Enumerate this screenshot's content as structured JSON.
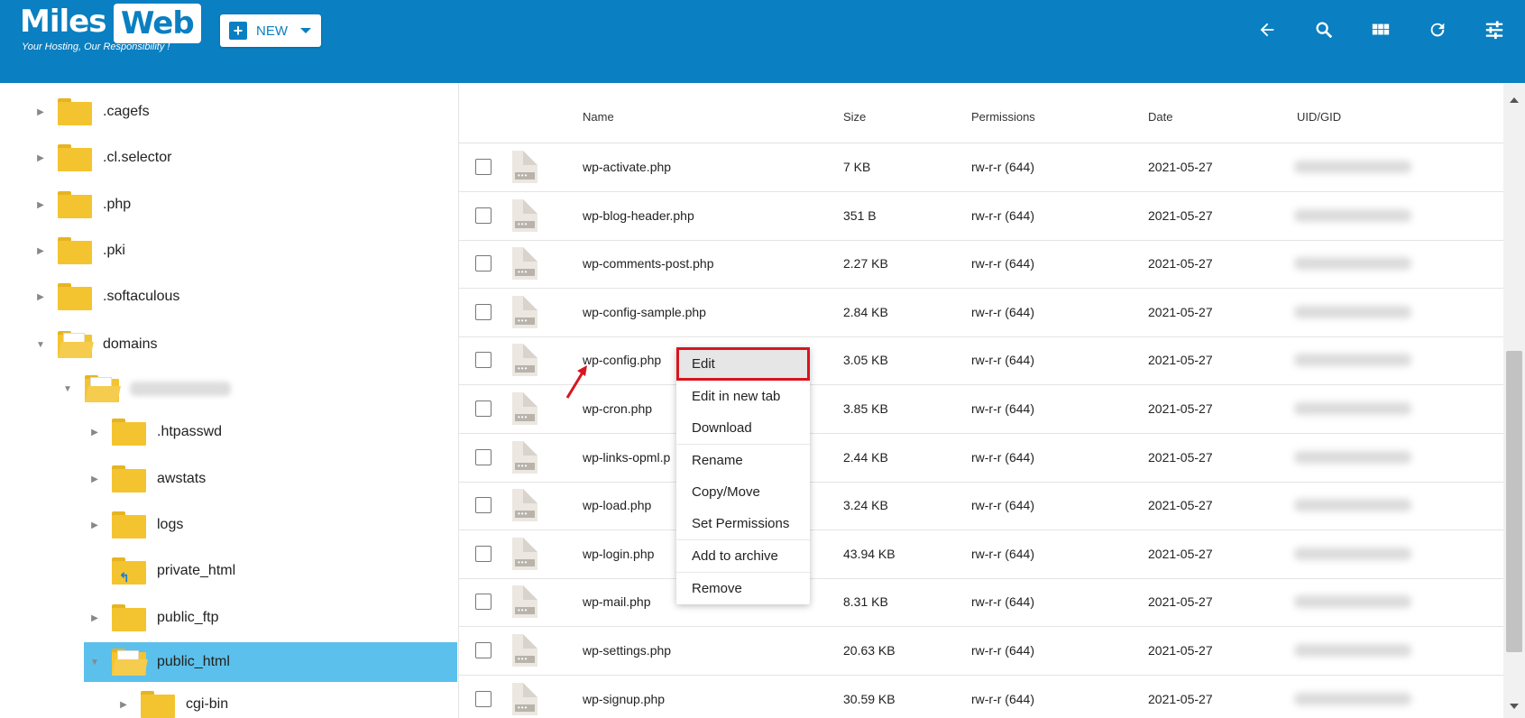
{
  "header": {
    "logo_miles": "Miles",
    "logo_web": "Web",
    "tagline": "Your Hosting, Our Responsibility !",
    "new_button": "NEW",
    "icons": [
      "back-arrow-icon",
      "search-icon",
      "grid-view-icon",
      "refresh-icon",
      "settings-sliders-icon"
    ],
    "accent_color": "#0a7fc1"
  },
  "sidebar": {
    "items": [
      {
        "label": ".cagefs",
        "expanded": false,
        "level": 0
      },
      {
        "label": ".cl.selector",
        "expanded": false,
        "level": 0
      },
      {
        "label": ".php",
        "expanded": false,
        "level": 0
      },
      {
        "label": ".pki",
        "expanded": false,
        "level": 0
      },
      {
        "label": ".softaculous",
        "expanded": false,
        "level": 0
      },
      {
        "label": "domains",
        "expanded": true,
        "level": 0
      },
      {
        "label": "",
        "expanded": true,
        "level": 1,
        "blurred": true
      },
      {
        "label": ".htpasswd",
        "expanded": false,
        "level": 2
      },
      {
        "label": "awstats",
        "expanded": false,
        "level": 2
      },
      {
        "label": "logs",
        "expanded": false,
        "level": 2
      },
      {
        "label": "private_html",
        "expanded": false,
        "level": 2,
        "link": true
      },
      {
        "label": "public_ftp",
        "expanded": false,
        "level": 2
      },
      {
        "label": "public_html",
        "expanded": true,
        "level": 2,
        "selected": true
      },
      {
        "label": "cgi-bin",
        "expanded": false,
        "level": 3
      }
    ],
    "selected_color": "#5bc0eb"
  },
  "table": {
    "columns": [
      "Name",
      "Size",
      "Permissions",
      "Date",
      "UID/GID"
    ],
    "rows": [
      {
        "name": "wp-activate.php",
        "size": "7 KB",
        "perm": "rw-r-r (644)",
        "date": "2021-05-27"
      },
      {
        "name": "wp-blog-header.php",
        "size": "351 B",
        "perm": "rw-r-r (644)",
        "date": "2021-05-27"
      },
      {
        "name": "wp-comments-post.php",
        "size": "2.27 KB",
        "perm": "rw-r-r (644)",
        "date": "2021-05-27"
      },
      {
        "name": "wp-config-sample.php",
        "size": "2.84 KB",
        "perm": "rw-r-r (644)",
        "date": "2021-05-27"
      },
      {
        "name": "wp-config.php",
        "size": "3.05 KB",
        "perm": "rw-r-r (644)",
        "date": "2021-05-27"
      },
      {
        "name": "wp-cron.php",
        "size": "3.85 KB",
        "perm": "rw-r-r (644)",
        "date": "2021-05-27"
      },
      {
        "name": "wp-links-opml.p",
        "size": "2.44 KB",
        "perm": "rw-r-r (644)",
        "date": "2021-05-27"
      },
      {
        "name": "wp-load.php",
        "size": "3.24 KB",
        "perm": "rw-r-r (644)",
        "date": "2021-05-27"
      },
      {
        "name": "wp-login.php",
        "size": "43.94 KB",
        "perm": "rw-r-r (644)",
        "date": "2021-05-27"
      },
      {
        "name": "wp-mail.php",
        "size": "8.31 KB",
        "perm": "rw-r-r (644)",
        "date": "2021-05-27"
      },
      {
        "name": "wp-settings.php",
        "size": "20.63 KB",
        "perm": "rw-r-r (644)",
        "date": "2021-05-27"
      },
      {
        "name": "wp-signup.php",
        "size": "30.59 KB",
        "perm": "rw-r-r (644)",
        "date": "2021-05-27"
      }
    ]
  },
  "context_menu": {
    "items": [
      {
        "label": "Edit",
        "highlighted": true
      },
      {
        "label": "Edit in new tab"
      },
      {
        "label": "Download"
      },
      {
        "label": "Rename"
      },
      {
        "label": "Copy/Move"
      },
      {
        "label": "Set Permissions"
      },
      {
        "label": "Add to archive"
      },
      {
        "label": "Remove"
      }
    ],
    "highlight_color": "#d9141e"
  }
}
